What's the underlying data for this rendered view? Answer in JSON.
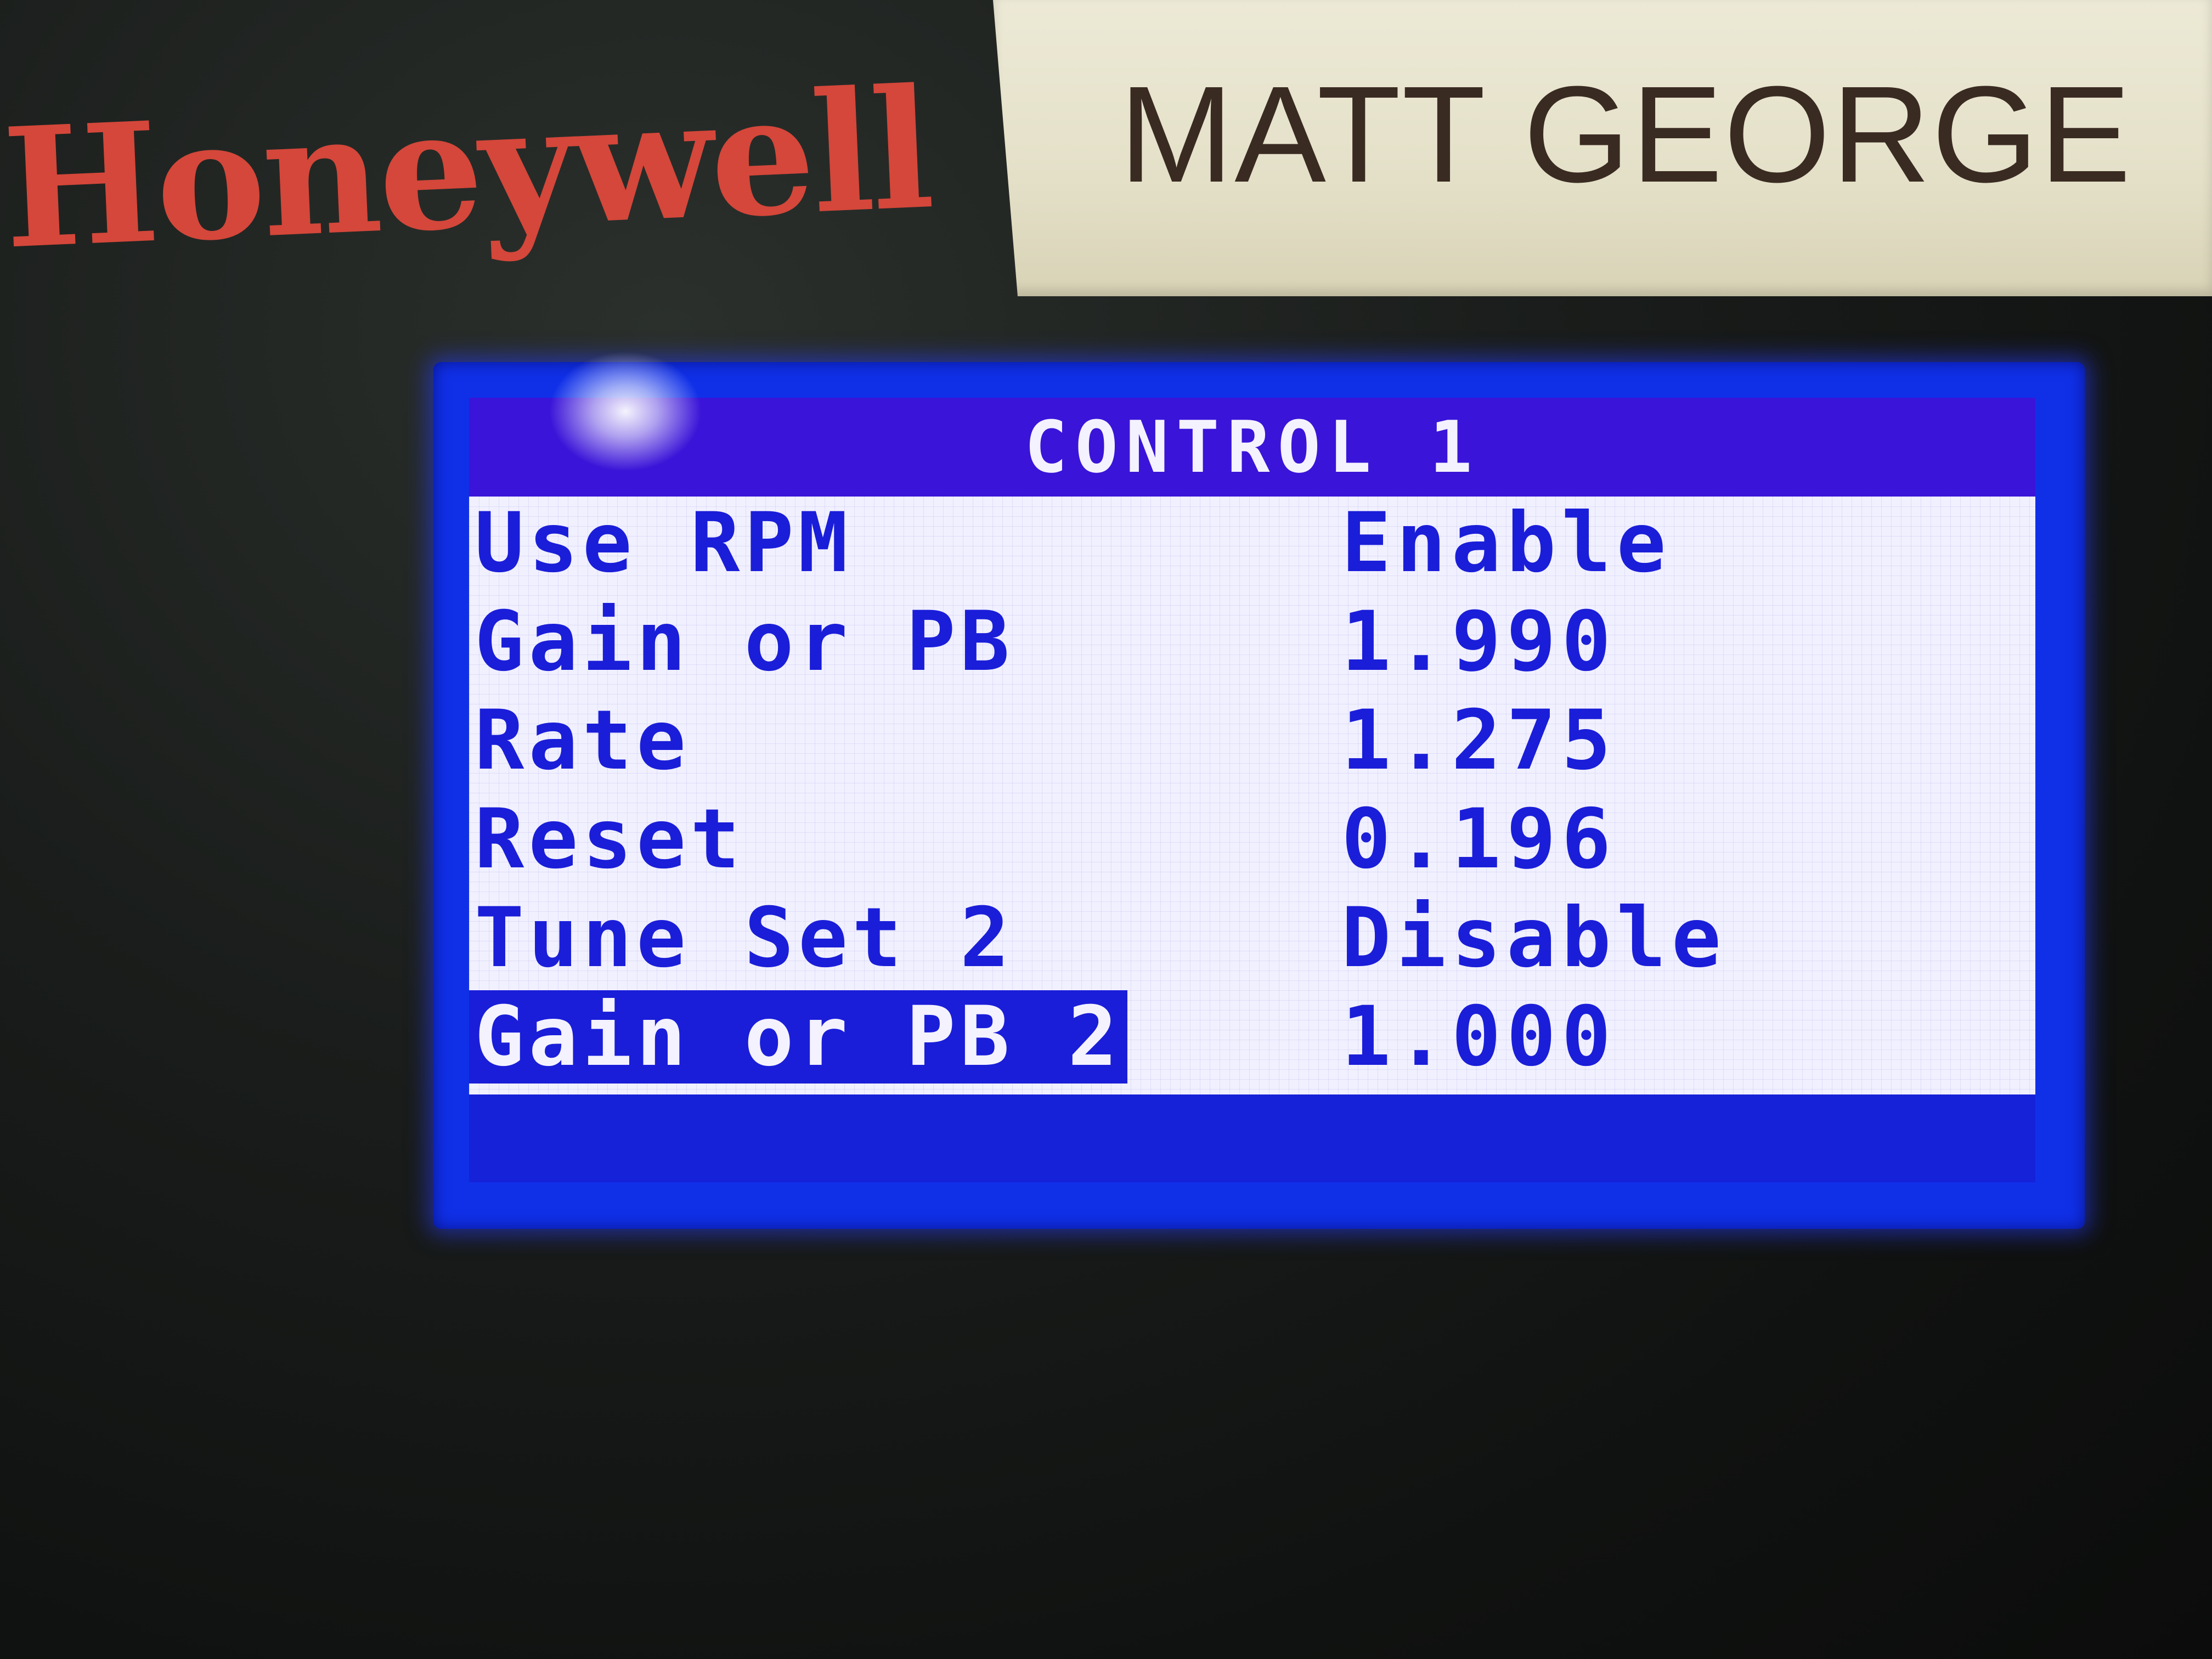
{
  "device": {
    "brand": "Honeywell",
    "name_label": "MATT GEORGE"
  },
  "screen": {
    "title": "CONTROL 1",
    "rows": [
      {
        "label": "Use RPM",
        "value": "Enable"
      },
      {
        "label": "Gain or PB",
        "value": "1.990"
      },
      {
        "label": "Rate",
        "value": "1.275"
      },
      {
        "label": "Reset",
        "value": "0.196"
      },
      {
        "label": "Tune Set 2",
        "value": "Disable"
      },
      {
        "label": "Gain or PB 2",
        "value": "1.000",
        "selected": true
      }
    ]
  },
  "colors": {
    "lcd_text": "#1a1ed8",
    "lcd_background": "#f1f0ff",
    "lcd_frame": "#1030e8",
    "brand": "#d4473a"
  }
}
